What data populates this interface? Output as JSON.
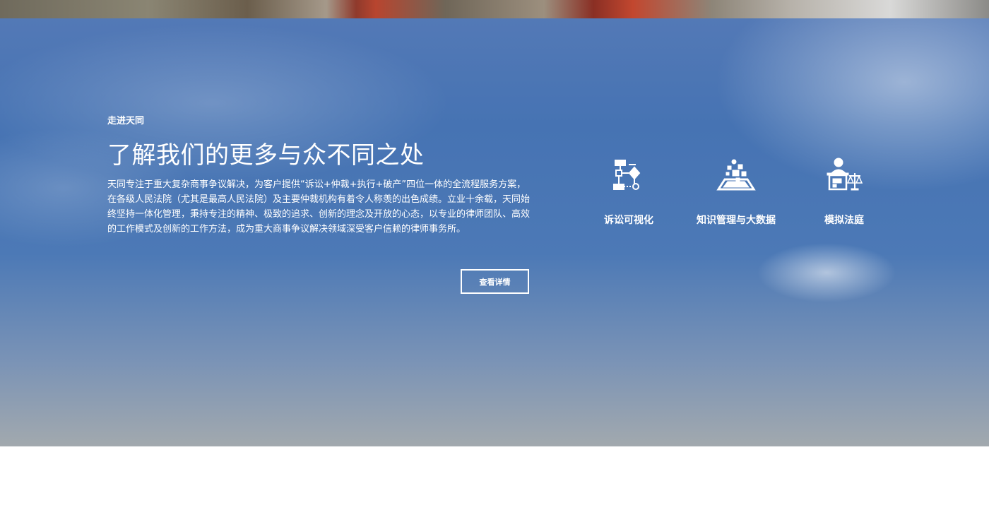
{
  "hero": {
    "eyebrow": "走进天同",
    "headline": "了解我们的更多与众不同之处",
    "intro": "天同专注于重大复杂商事争议解决，为客户提供“诉讼+仲裁+执行+破产”四位一体的全流程服务方案，在各级人民法院（尤其是最高人民法院）及主要仲裁机构有着令人称羡的出色成绩。立业十余载，天同始终坚持一体化管理，秉持专注的精神、极致的追求、创新的理念及开放的心态，以专业的律师团队、高效的工作模式及创新的工作方法，成为重大商事争议解决领域深受客户信赖的律师事务所。",
    "button_label": "查看详情"
  },
  "features": [
    {
      "label": "诉讼可视化",
      "icon": "flowchart-icon"
    },
    {
      "label": "知识管理与大数据",
      "icon": "data-platform-icon"
    },
    {
      "label": "模拟法庭",
      "icon": "courtroom-judge-icon"
    }
  ],
  "colors": {
    "sky_blue": "#4673b3",
    "text": "#ffffff"
  }
}
